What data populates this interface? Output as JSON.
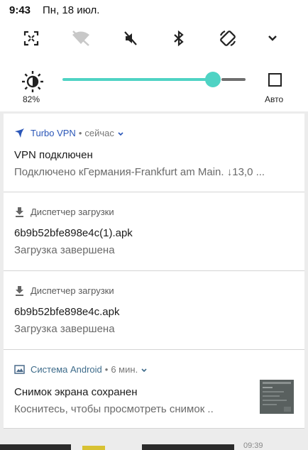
{
  "status_bar": {
    "time": "9:43",
    "date": "Пн, 18 июл."
  },
  "quick_tiles": [
    {
      "icon": "screenshot-expand-icon",
      "active": true
    },
    {
      "icon": "wifi-off-icon",
      "active": false
    },
    {
      "icon": "sound-mute-icon",
      "active": true
    },
    {
      "icon": "bluetooth-icon",
      "active": true
    },
    {
      "icon": "auto-rotate-icon",
      "active": true
    },
    {
      "icon": "chevron-down-icon",
      "active": true
    }
  ],
  "brightness": {
    "percent_label": "82%",
    "level": 0.82,
    "auto_label": "Авто",
    "accent": "#4fd3c4"
  },
  "notifications": [
    {
      "app": "Turbo VPN",
      "time": "сейчас",
      "title": "VPN подключен",
      "text": "Подключено кГермания-Frankfurt am Main. ↓13,0 ..."
    },
    {
      "app": "Диспетчер загрузки",
      "title": "6b9b52bfe898e4c(1).apk",
      "text": "Загрузка завершена"
    },
    {
      "app": "Диспетчер загрузки",
      "title": "6b9b52bfe898e4c.apk",
      "text": "Загрузка завершена"
    },
    {
      "app": "Система Android",
      "time": "6 мин.",
      "title": "Снимок экрана сохранен",
      "text": "Коснитесь, чтобы просмотреть снимок .."
    }
  ],
  "background_clock": "09:39"
}
